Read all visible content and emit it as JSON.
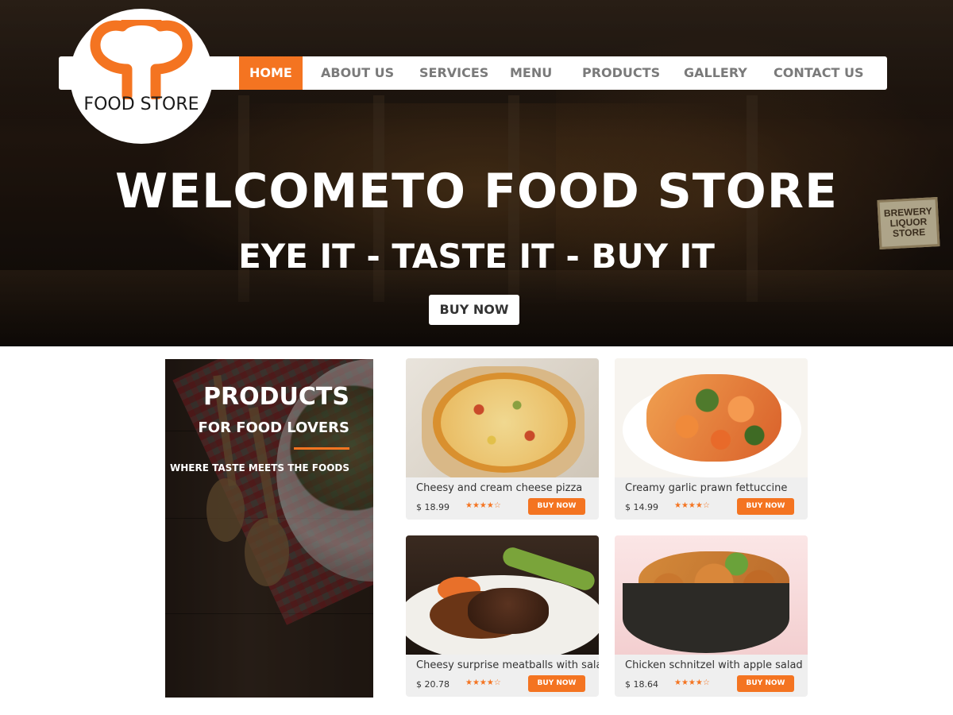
{
  "logo": {
    "text": "FOOD STORE",
    "color": "#f47421"
  },
  "nav": {
    "items": [
      "HOME",
      "ABOUT US",
      "SERVICES",
      "MENU",
      "PRODUCTS",
      "GALLERY",
      "CONTACT US"
    ],
    "active": "HOME"
  },
  "hero": {
    "title": "WELCOMETO FOOD STORE",
    "subtitle": "EYE IT - TASTE IT - BUY IT",
    "cta": "BUY NOW",
    "sign_text": "BREWERY LIQUOR STORE"
  },
  "promo": {
    "title": "PRODUCTS",
    "subtitle": "FOR FOOD LOVERS",
    "tagline": "WHERE TASTE MEETS THE FOODS"
  },
  "products": [
    {
      "name": "Cheesy and cream cheese pizza",
      "price": "$ 18.99",
      "rating": 4,
      "rating_display": "★★★★☆",
      "button": "BUY NOW"
    },
    {
      "name": "Creamy garlic prawn fettuccine",
      "price": "$ 14.99",
      "rating": 4,
      "rating_display": "★★★★☆",
      "button": "BUY NOW"
    },
    {
      "name": "Cheesy surprise meatballs with salad",
      "price": "$ 20.78",
      "rating": 4,
      "rating_display": "★★★★☆",
      "button": "BUY NOW"
    },
    {
      "name": "Chicken schnitzel with apple salad",
      "price": "$ 18.64",
      "rating": 4,
      "rating_display": "★★★★☆",
      "button": "BUY NOW"
    }
  ],
  "colors": {
    "accent": "#f47421",
    "card_bg": "#efefef",
    "nav_text": "#7a7a7a"
  }
}
